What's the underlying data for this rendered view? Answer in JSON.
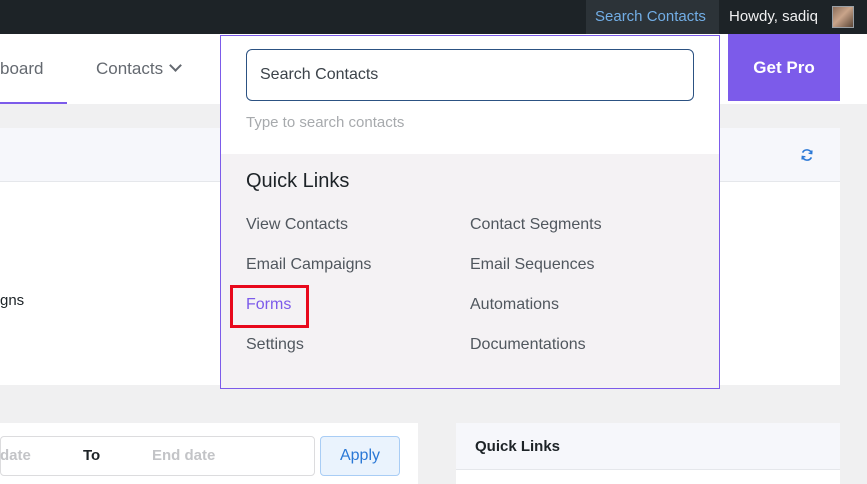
{
  "adminbar": {
    "search_label": "Search Contacts",
    "howdy": "Howdy, sadiq"
  },
  "nav": {
    "dashboard_label": "board",
    "contacts_label": "Contacts",
    "get_pro_label": "Get Pro"
  },
  "background": {
    "campaigns_fragment": "gns",
    "start_date_placeholder": "date",
    "to_label": "To",
    "end_date_placeholder": "End date",
    "apply_label": "Apply",
    "quick_links_title": "Quick Links"
  },
  "dropdown": {
    "search_placeholder": "Search Contacts",
    "hint": "Type to search contacts",
    "title": "Quick Links",
    "links": [
      "View Contacts",
      "Contact Segments",
      "Email Campaigns",
      "Email Sequences",
      "Forms",
      "Automations",
      "Settings",
      "Documentations"
    ],
    "active_link": "Forms"
  },
  "colors": {
    "accent": "#7c5bea",
    "highlight": "#e8091c",
    "link_blue": "#72aee6"
  }
}
